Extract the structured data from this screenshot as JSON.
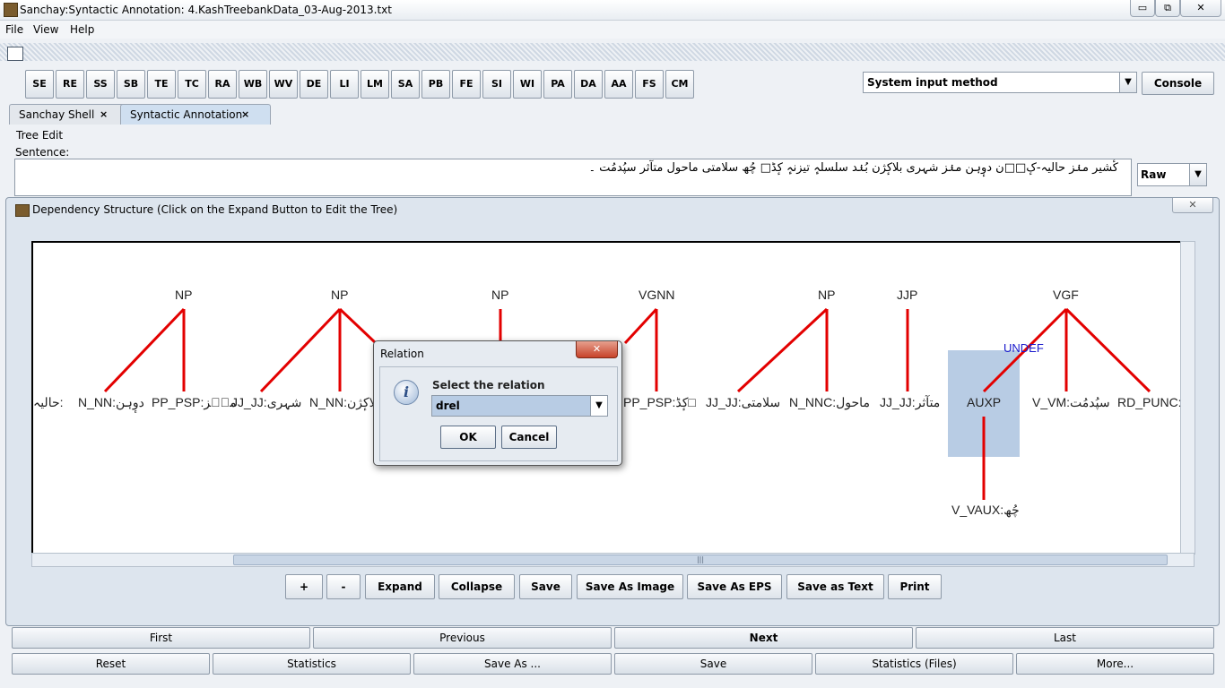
{
  "window": {
    "title": "Sanchay:Syntactic Annotation: 4.KashTreebankData_03-Aug-2013.txt",
    "controls": [
      "▭",
      "⧉",
      "✕"
    ]
  },
  "menu": [
    "File",
    "View",
    "Help"
  ],
  "toolbar": {
    "buttons": [
      "SE",
      "RE",
      "SS",
      "SB",
      "TE",
      "TC",
      "RA",
      "WB",
      "WV",
      "DE",
      "LI",
      "LM",
      "SA",
      "PB",
      "FE",
      "SI",
      "WI",
      "PA",
      "DA",
      "AA",
      "FS",
      "CM"
    ],
    "input_method": "System input method",
    "console": "Console"
  },
  "tabs": [
    {
      "label": "Sanchay Shell",
      "close": "×"
    },
    {
      "label": "Syntactic Annotation",
      "close": "×"
    }
  ],
  "tree_edit": {
    "title": "Tree Edit",
    "sentence_label": "Sentence:",
    "sentence": "کٔشیر منٛز حالیہ-کٕ□□ن دوٕہن منٛز شہری بلاکٕژن بُنٛد سلسلہٕ تیزنہٕ کٕڈ□ چُھ سلامتی ماحول متآثر سپُدمُت ۔",
    "format": "Raw"
  },
  "dependency": {
    "title": "Dependency Structure (Click on the Expand Button to Edit the Tree)",
    "close": "✕",
    "phrases": [
      "NP",
      "NP",
      "NP",
      "VGNN",
      "NP",
      "JJP",
      "VGF"
    ],
    "leaves": [
      "حالیہ:",
      "N_NN:دوٕہن",
      "PP_PSP:منٛز",
      "JJ_JJ:شہری",
      "N_NN:بلاکٕژن",
      "PP_PSP:کٕڈ□",
      "JJ_JJ:سلامتی",
      "N_NNC:ماحول",
      "JJ_JJ:متآثر",
      "AUXP",
      "V_VM:سپُدمُت",
      "RD_PUNC:"
    ],
    "child_leaf": "V_VAUX:چُھ",
    "relation_label": "UNDEF",
    "buttons": [
      "+",
      "-",
      "Expand",
      "Collapse",
      "Save",
      "Save As Image",
      "Save As EPS",
      "Save as Text",
      "Print"
    ],
    "scroll_grip": "|||"
  },
  "dialog": {
    "title": "Relation",
    "close": "✕",
    "icon": "i",
    "prompt": "Select the relation",
    "selected": "drel",
    "ok": "OK",
    "cancel": "Cancel"
  },
  "navigation": {
    "row1": [
      "First",
      "Previous",
      "Next",
      "Last"
    ],
    "row2": [
      "Reset",
      "Statistics",
      "Save As ...",
      "Save",
      "Statistics (Files)",
      "More..."
    ]
  },
  "colors": {
    "edge": "#e30000",
    "selection": "#b8cce4",
    "relation_text": "#1a1acc"
  }
}
